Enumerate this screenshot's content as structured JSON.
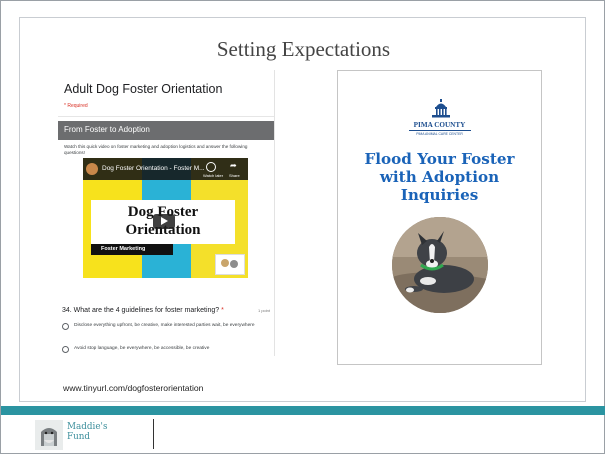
{
  "slide": {
    "title": "Setting Expectations",
    "url": "www.tinyurl.com/dogfosterorientation"
  },
  "form": {
    "title": "Adult Dog Foster Orientation",
    "required_note": "* Required",
    "section_title": "From Foster to Adoption",
    "section_desc": "Watch this quick video on foster marketing and adoption logistics and answer the following questions!",
    "video": {
      "title": "Dog Foster Orientation - Foster M...",
      "watch_later": "Watch later",
      "share": "Share",
      "heading_line1": "Dog Foster",
      "heading_line2": "Orientation",
      "tag": "Foster Marketing"
    },
    "question": {
      "text": "34. What are the 4 guidelines for foster marketing?",
      "required_mark": "*",
      "points": "1 point",
      "options": [
        "Disclose everything upfront, be creative, make interested parties wait, be everywhere",
        "Avoid stop language, be everywhere, be accessible, be creative"
      ]
    }
  },
  "poster": {
    "org_name": "PIMA COUNTY",
    "org_sub": "PIMA ANIMAL CARE CENTER",
    "headline_line1": "Flood Your Foster",
    "headline_line2": "with Adoption",
    "headline_line3": "Inquiries"
  },
  "footer": {
    "logo_line1": "Maddie's",
    "logo_line2": "Fund"
  },
  "colors": {
    "teal_bar": "#2b94a1",
    "headline_blue": "#1a63b8",
    "section_bar": "#6c6d6f"
  }
}
